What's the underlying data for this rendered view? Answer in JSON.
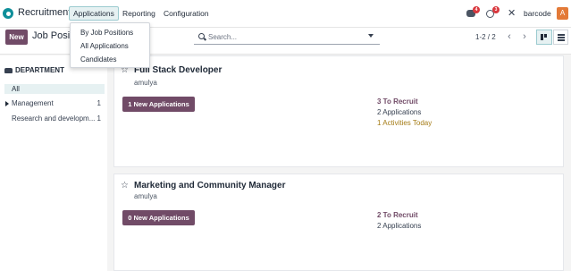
{
  "navbar": {
    "app_name": "Recruitment",
    "menu": [
      "Applications",
      "Reporting",
      "Configuration"
    ],
    "active_menu": "Applications",
    "messages_badge": "4",
    "activities_badge": "3",
    "company": "barcode",
    "avatar_letter": "A",
    "accent_color": "#714b67",
    "badge_color": "#d9373d",
    "avatar_color": "#e37a38"
  },
  "applications_dropdown": {
    "items": [
      "By Job Positions",
      "All Applications",
      "Candidates"
    ]
  },
  "control_panel": {
    "new_label": "New",
    "title": "Job Positio",
    "search_placeholder": "Search...",
    "pager": "1-2 / 2"
  },
  "sidebar": {
    "heading": "DEPARTMENT",
    "items": [
      {
        "label": "All",
        "count": ""
      },
      {
        "label": "Management",
        "count": "1"
      },
      {
        "label": "Research and developm...",
        "count": "1"
      }
    ]
  },
  "jobs": [
    {
      "title": "Full Stack Developer",
      "user": "amulya",
      "button": "1 New Applications",
      "to_recruit": "3 To Recruit",
      "applications": "2 Applications",
      "activities": "1 Activities Today"
    },
    {
      "title": "Marketing and Community Manager",
      "user": "amulya",
      "button": "0 New Applications",
      "to_recruit": "2 To Recruit",
      "applications": "2 Applications",
      "activities": ""
    }
  ]
}
